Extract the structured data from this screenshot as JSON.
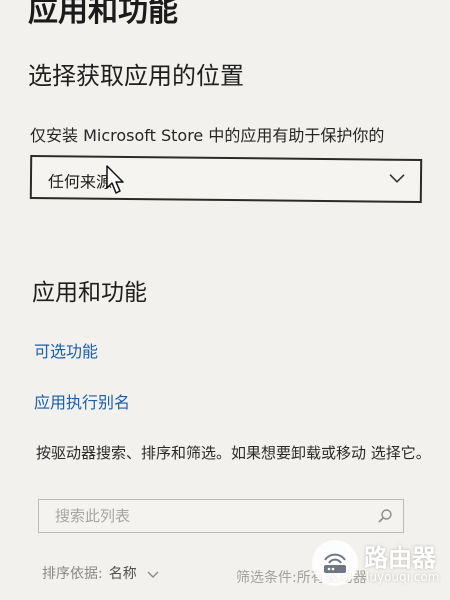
{
  "page": {
    "title": "应用和功能"
  },
  "install_source": {
    "heading": "选择获取应用的位置",
    "description": "仅安装 Microsoft Store 中的应用有助于保护你的",
    "selected_value": "任何来源"
  },
  "apps_features": {
    "heading": "应用和功能",
    "optional_features_link": "可选功能",
    "app_alias_link": "应用执行别名",
    "helper_text": "按驱动器搜索、排序和筛选。如果想要卸载或移动 选择它。",
    "search_placeholder": "搜索此列表",
    "sort_label": "排序依据:",
    "sort_value": "名称",
    "filter_label": "筛选条件:所有驱动器"
  },
  "watermark": {
    "brand": "路由器",
    "url": "luyouqi.com"
  },
  "icons": {
    "dropdown": "chevron-down-icon",
    "cursor": "mouse-cursor-icon",
    "search": "search-icon",
    "router_logo": "router-logo-icon"
  }
}
